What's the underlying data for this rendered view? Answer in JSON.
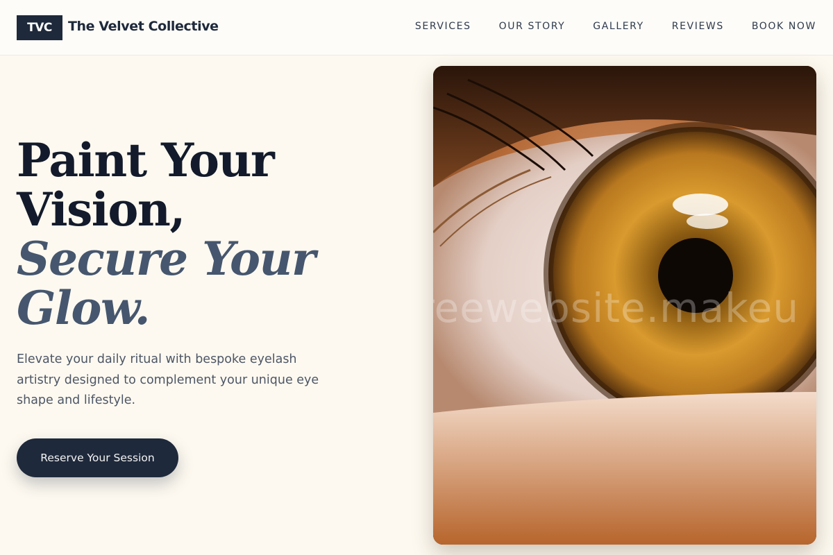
{
  "header": {
    "logo_badge": "TVC",
    "brand_name": "The Velvet Collective",
    "nav": [
      {
        "label": "SERVICES"
      },
      {
        "label": "OUR STORY"
      },
      {
        "label": "GALLERY"
      },
      {
        "label": "REVIEWS"
      },
      {
        "label": "BOOK NOW"
      }
    ]
  },
  "hero": {
    "headline_line1": "Paint Your",
    "headline_line2": "Vision,",
    "headline_accent1": "Secure Your",
    "headline_accent2": "Glow.",
    "subtext": "Elevate your daily ritual with bespoke eyelash artistry designed to complement your unique eye shape and lifestyle.",
    "cta_label": "Reserve Your Session",
    "image": {
      "subject": "close-up-eye-photo",
      "watermark": "reewebsite.makeu"
    }
  },
  "colors": {
    "background": "#fdf9f0",
    "primary": "#1e293b",
    "accent_text": "#46566e",
    "body_text": "#4d5666"
  }
}
